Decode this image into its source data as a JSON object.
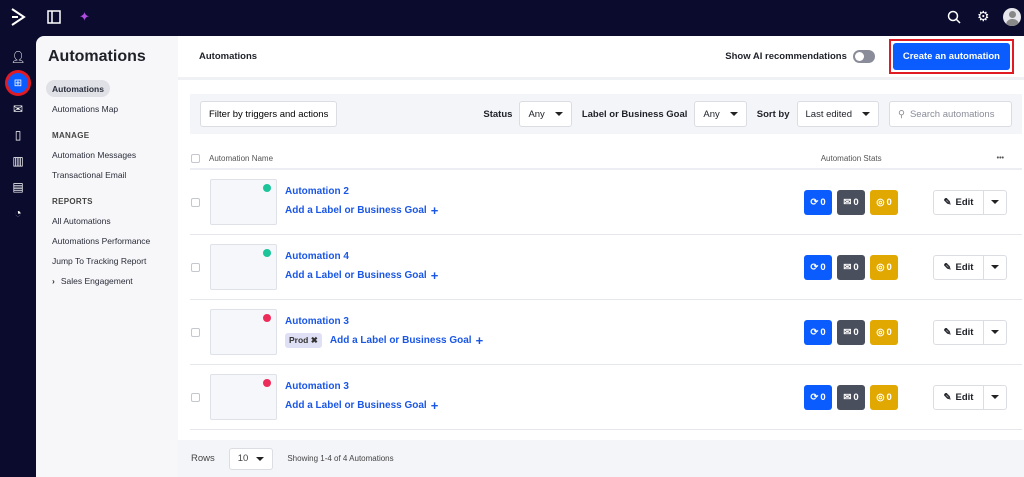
{
  "topbar": {
    "logo": "logo-chevron",
    "icons": [
      "sidebar-toggle-icon",
      "sparkle-icon",
      "search-icon",
      "gear-icon",
      "avatar-icon"
    ]
  },
  "rail": [
    "contacts-icon",
    "automations-icon",
    "email-icon",
    "mobile-icon",
    "pipeline-icon",
    "website-icon",
    "reports-icon"
  ],
  "sidebar": {
    "title": "Automations",
    "items": [
      "Automations",
      "Automations Map"
    ],
    "manage_title": "MANAGE",
    "manage": [
      "Automation Messages",
      "Transactional Email"
    ],
    "reports_title": "REPORTS",
    "reports": [
      "All Automations",
      "Automations Performance",
      "Jump To Tracking Report",
      "Sales Engagement"
    ]
  },
  "header": {
    "title": "Automations",
    "ai_label": "Show AI recommendations",
    "cta": "Create an automation"
  },
  "filters": {
    "filter_btn": "Filter by triggers and actions",
    "status_label": "Status",
    "status_value": "Any",
    "label_label": "Label or Business Goal",
    "label_value": "Any",
    "sort_label": "Sort by",
    "sort_value": "Last edited",
    "search_placeholder": "Search automations"
  },
  "table": {
    "col_name": "Automation Name",
    "col_stats": "Automation Stats",
    "more": "•••",
    "rows": [
      {
        "name": "Automation 2",
        "status_color": "#1cc49a",
        "tag": null,
        "add_label": "Add a Label or Business Goal",
        "contacts": "0",
        "emails": "0",
        "goals": "0",
        "edit": "Edit"
      },
      {
        "name": "Automation 4",
        "status_color": "#1cc49a",
        "tag": null,
        "add_label": "Add a Label or Business Goal",
        "contacts": "0",
        "emails": "0",
        "goals": "0",
        "edit": "Edit"
      },
      {
        "name": "Automation 3",
        "status_color": "#ee2c5a",
        "tag": "Prod",
        "add_label": "Add a Label or Business Goal",
        "contacts": "0",
        "emails": "0",
        "goals": "0",
        "edit": "Edit"
      },
      {
        "name": "Automation 3",
        "status_color": "#ee2c5a",
        "tag": null,
        "add_label": "Add a Label or Business Goal",
        "contacts": "0",
        "emails": "0",
        "goals": "0",
        "edit": "Edit"
      }
    ]
  },
  "footer": {
    "rows_label": "Rows",
    "rows_value": "10",
    "showing": "Showing 1-4 of 4 Automations"
  },
  "colors": {
    "accent": "#0a5cff",
    "contacts": "#0a5cff",
    "emails": "#4a4f5e",
    "goals": "#e0a800",
    "nav": "#0b0b2e"
  }
}
